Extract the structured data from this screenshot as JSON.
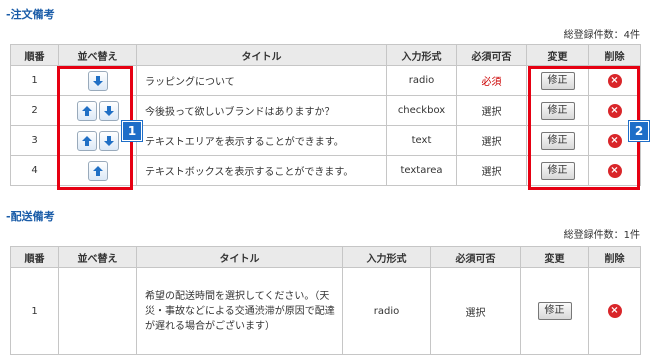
{
  "section1": {
    "title": "-注文備考",
    "count": "総登録件数：4件",
    "headers": [
      "順番",
      "並べ替え",
      "タイトル",
      "入力形式",
      "必須可否",
      "変更",
      "削除"
    ],
    "rows": [
      {
        "order": "1",
        "title": "ラッピングについて",
        "type": "radio",
        "required": "必須",
        "edit": "修正"
      },
      {
        "order": "2",
        "title": "今後扱って欲しいブランドはありますか？",
        "type": "checkbox",
        "required": "選択",
        "edit": "修正"
      },
      {
        "order": "3",
        "title": "テキストエリアを表示することができます。",
        "type": "text",
        "required": "選択",
        "edit": "修正"
      },
      {
        "order": "4",
        "title": "テキストボックスを表示することができます。",
        "type": "textarea",
        "required": "選択",
        "edit": "修正"
      }
    ],
    "badge1": "1",
    "badge2": "2"
  },
  "section2": {
    "title": "-配送備考",
    "count": "総登録件数：1件",
    "headers": [
      "順番",
      "並べ替え",
      "タイトル",
      "入力形式",
      "必須可否",
      "変更",
      "削除"
    ],
    "rows": [
      {
        "order": "1",
        "title": "希望の配送時間を選択してください。（天災・事故などによる交通渋滞が原因で配達が遅れる場合がございます）",
        "type": "radio",
        "required": "選択",
        "edit": "修正"
      }
    ]
  },
  "colors": {
    "accent": "#1a5ca8",
    "highlight": "#e60012",
    "badge": "#1e6ec8",
    "delete": "#d9262a"
  },
  "icons": {
    "up": "arrow-up-icon",
    "down": "arrow-down-icon",
    "delete": "delete-x-icon"
  }
}
